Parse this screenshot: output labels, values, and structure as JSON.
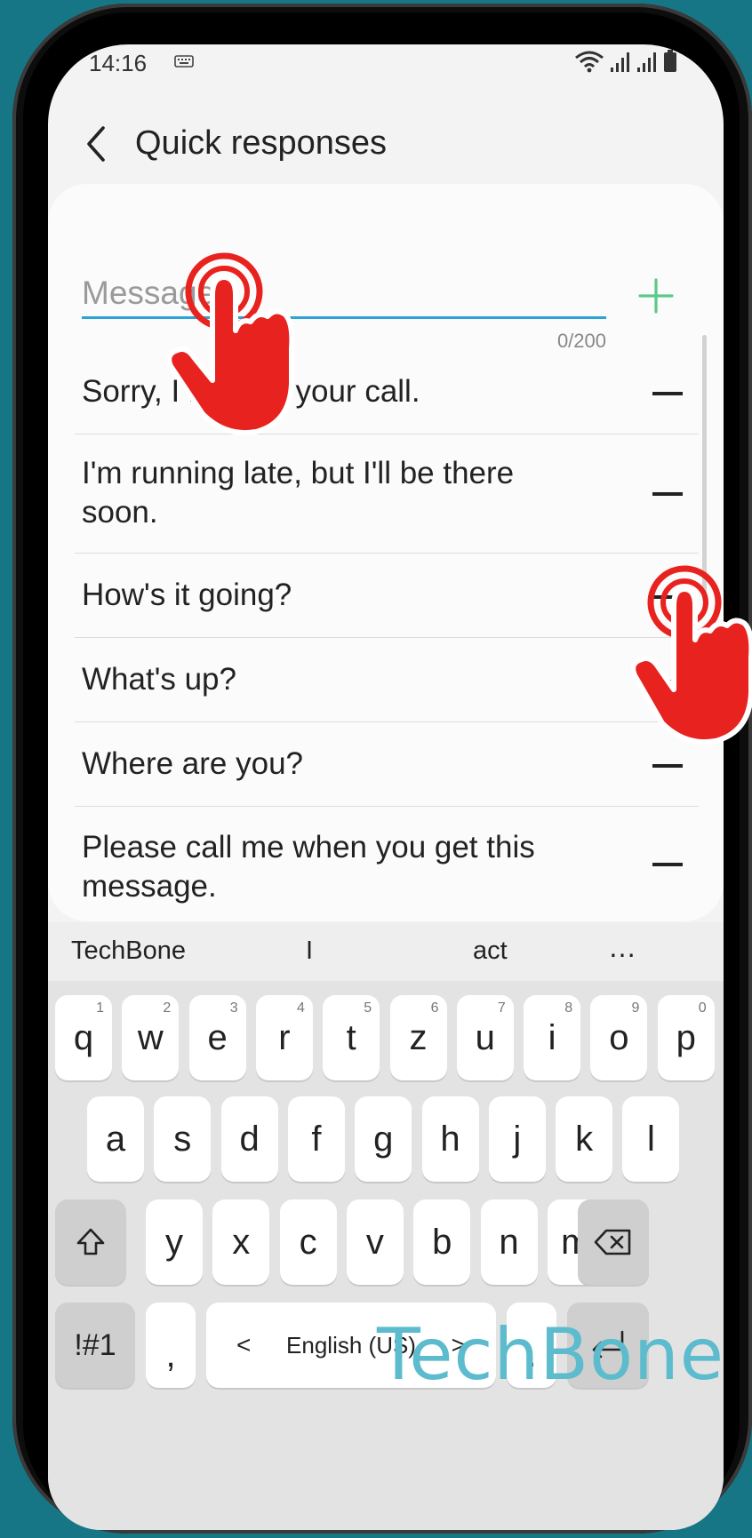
{
  "status_bar": {
    "time": "14:16"
  },
  "header": {
    "title": "Quick responses"
  },
  "message_input": {
    "placeholder": "Message",
    "char_count": "0/200"
  },
  "responses": [
    "Sorry, I missed your call.",
    "I'm running late, but I'll be there soon.",
    "How's it going?",
    "What's up?",
    "Where are you?",
    "Please call me when you get this message."
  ],
  "suggestions": {
    "left": "TechBone",
    "middle": "I",
    "right": "act",
    "more": "…"
  },
  "keyboard": {
    "row1": [
      {
        "k": "q",
        "h": "1"
      },
      {
        "k": "w",
        "h": "2"
      },
      {
        "k": "e",
        "h": "3"
      },
      {
        "k": "r",
        "h": "4"
      },
      {
        "k": "t",
        "h": "5"
      },
      {
        "k": "z",
        "h": "6"
      },
      {
        "k": "u",
        "h": "7"
      },
      {
        "k": "i",
        "h": "8"
      },
      {
        "k": "o",
        "h": "9"
      },
      {
        "k": "p",
        "h": "0"
      }
    ],
    "row2": [
      "a",
      "s",
      "d",
      "f",
      "g",
      "h",
      "j",
      "k",
      "l"
    ],
    "row3": [
      "y",
      "x",
      "c",
      "v",
      "b",
      "n",
      "m"
    ],
    "symbols": "!#1",
    "comma": ",",
    "space": "English (US)",
    "space_left": "<",
    "space_right": ">",
    "period": "."
  },
  "watermark": "TechBone",
  "colors": {
    "background": "#177686",
    "accent": "#2ea3d6",
    "add": "#5cc98a",
    "hand": "#e8231f"
  }
}
